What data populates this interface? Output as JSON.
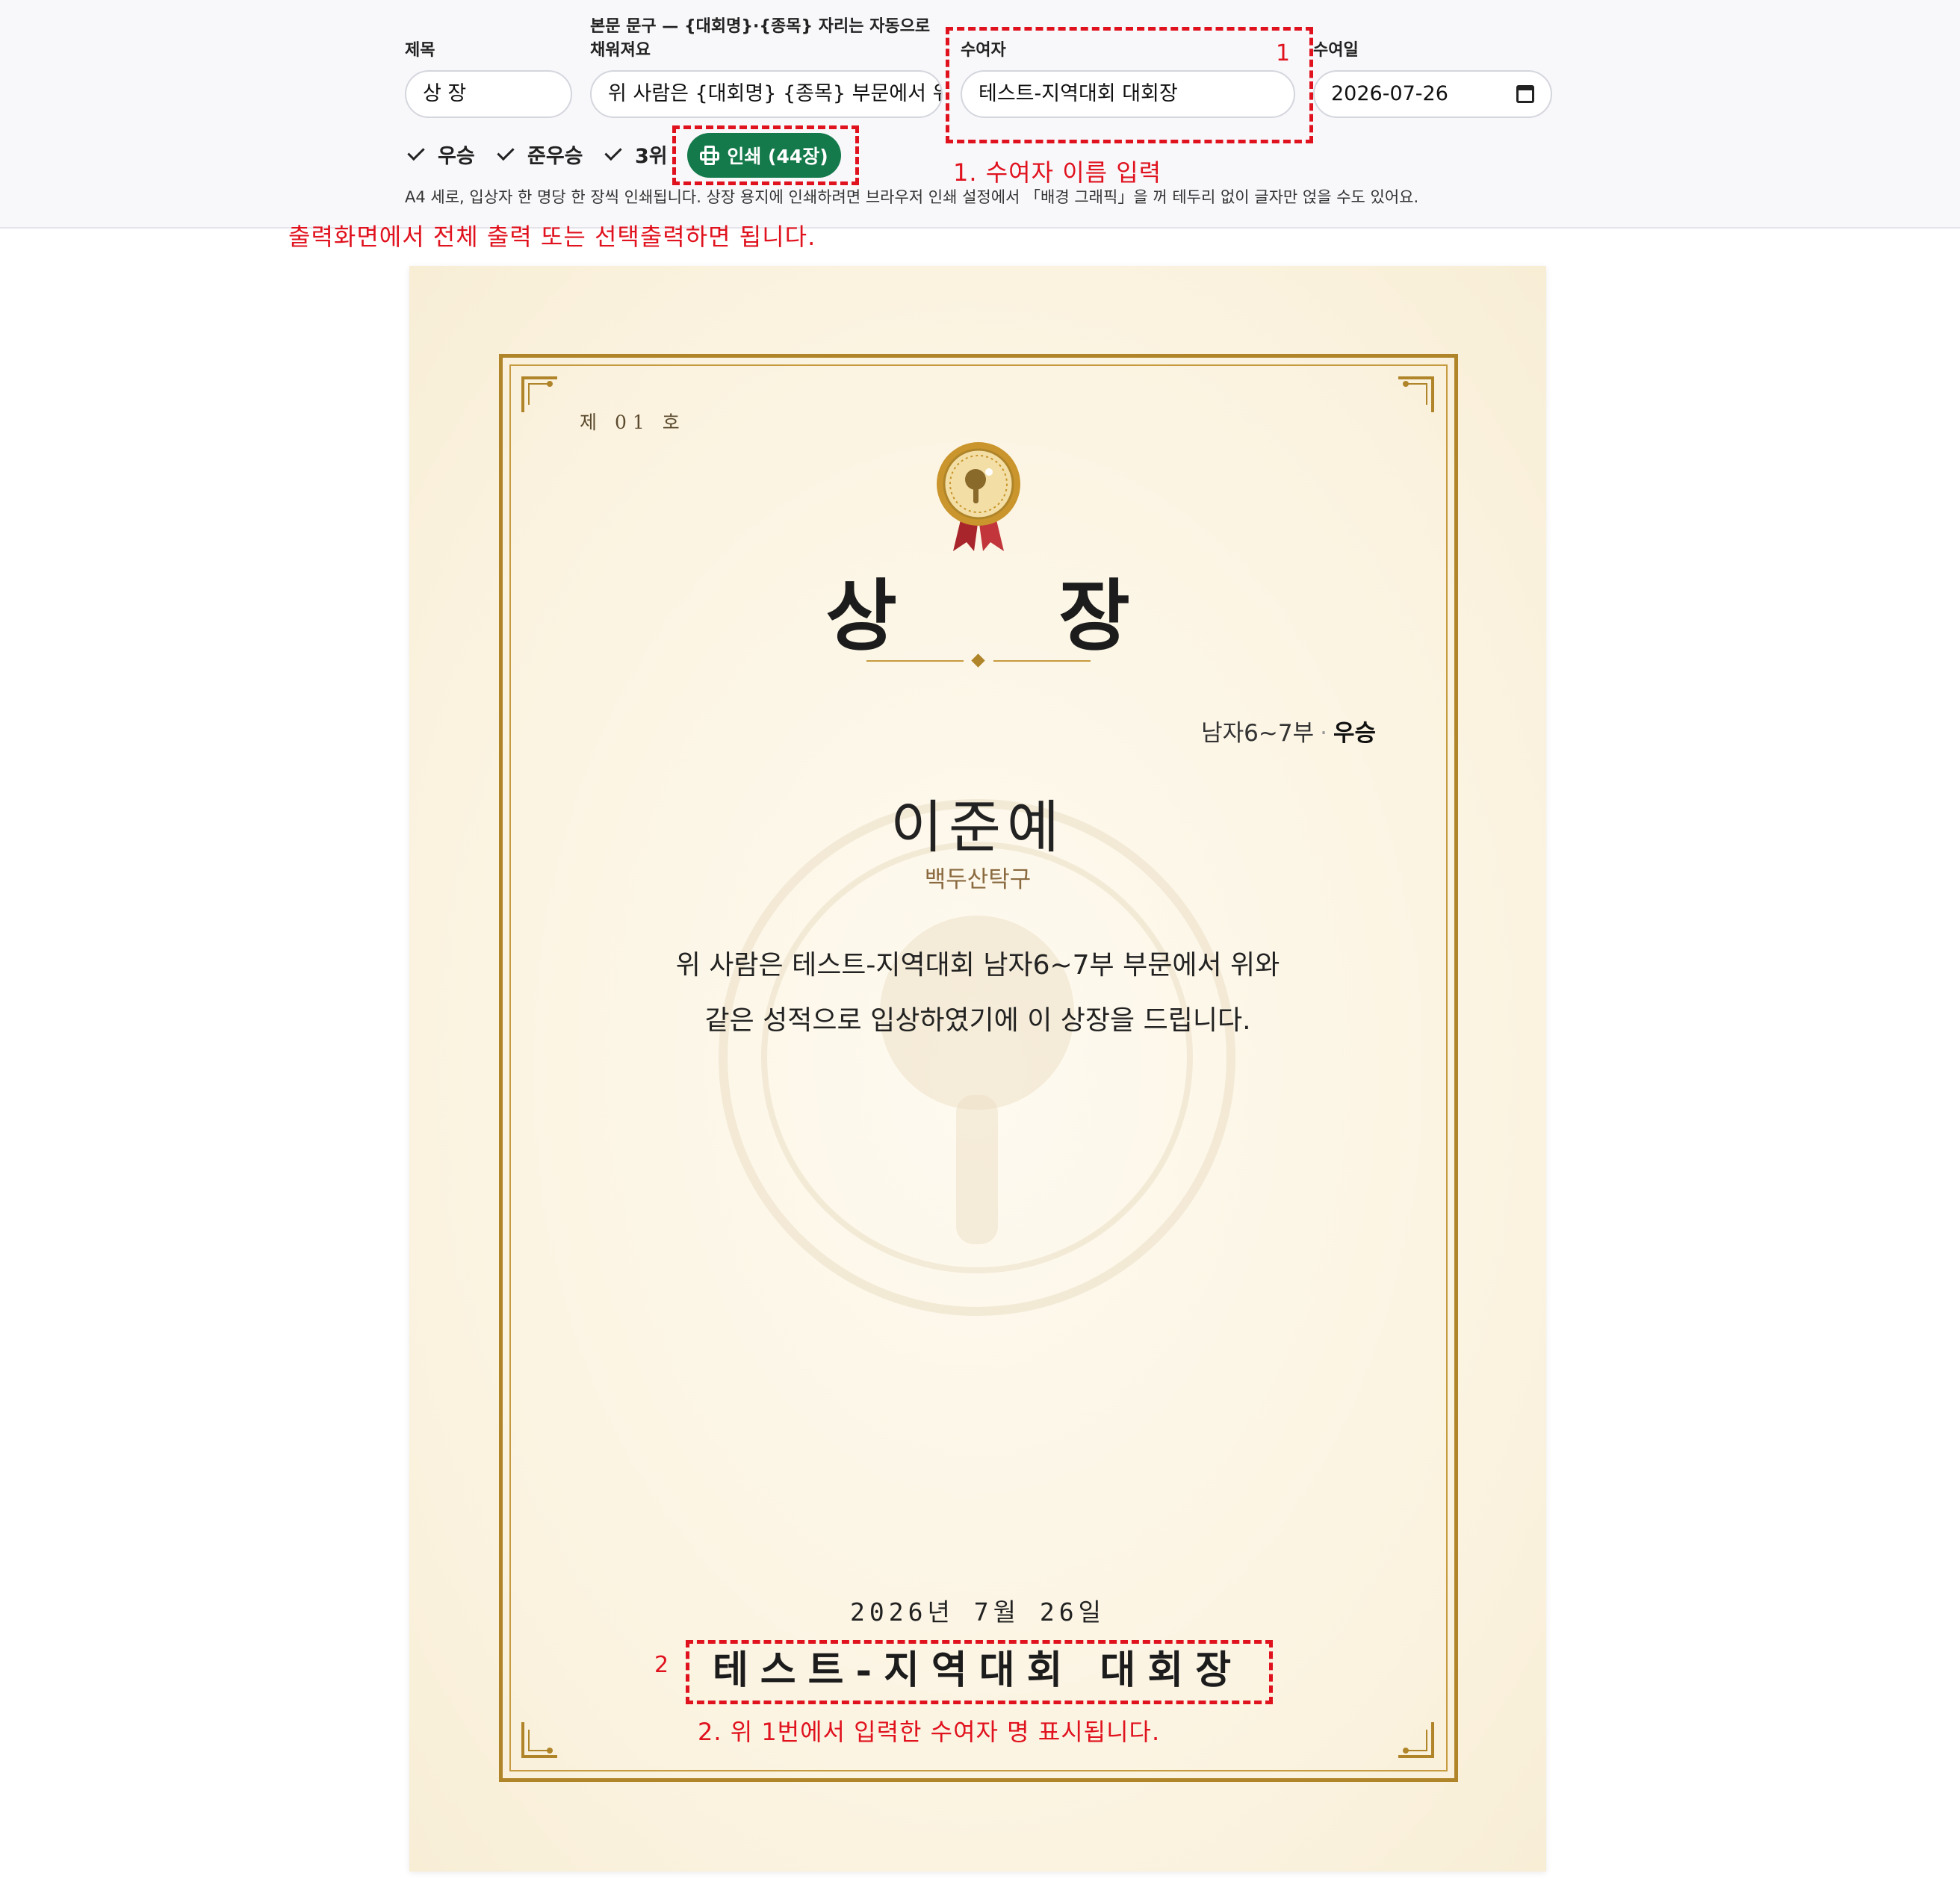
{
  "controls": {
    "title_label": "제목",
    "title_value": "상 장",
    "body_label_line1": "본문 문구 — {대회명}·{종목} 자리는 자동으로",
    "body_label_line2": "채워져요",
    "body_value": "위 사람은 {대회명} {종목} 부문에서 위",
    "presenter_label": "수여자",
    "presenter_value": "테스트-지역대회 대회장",
    "date_label": "수여일",
    "date_value": "2026-07-26",
    "checkboxes": [
      {
        "label": "우승",
        "checked": true
      },
      {
        "label": "준우승",
        "checked": true
      },
      {
        "label": "3위",
        "checked": true
      }
    ],
    "print_button": "인쇄 (44장)",
    "help_text": "A4 세로, 입상자 한 명당 한 장씩 인쇄됩니다. 상장 용지에 인쇄하려면 브라우저 인쇄 설정에서 「배경 그래픽」을 꺼 테두리 없이 글자만 얹을 수도 있어요."
  },
  "annotations": {
    "marker_1": "1",
    "note_1": "1. 수여자 이름 입력",
    "note_print": "출력화면에서 전체 출력 또는 선택출력하면 됩니다.",
    "marker_2": "2",
    "note_2": "2. 위 1번에서 입력한 수여자 명 표시됩니다.",
    "color": "#e0121e"
  },
  "certificate": {
    "number": "제 01 호",
    "title": "상 장",
    "division": "남자6~7부",
    "separator": "·",
    "rank": "우승",
    "winner_name": "이준예",
    "club": "백두산탁구",
    "body_line1": "위 사람은 테스트-지역대회 남자6~7부 부문에서 위와",
    "body_line2": "같은 성적으로 입상하였기에 이 상장을 드립니다.",
    "date": "2026년 7월 26일",
    "presenter": "테스트-지역대회 대회장",
    "frame_color": "#b0852a",
    "paper_color": "#fbf3e0"
  },
  "icons": [
    "printer-icon",
    "calendar-icon",
    "check-icon",
    "medal-icon",
    "ping-pong-paddle-watermark"
  ]
}
